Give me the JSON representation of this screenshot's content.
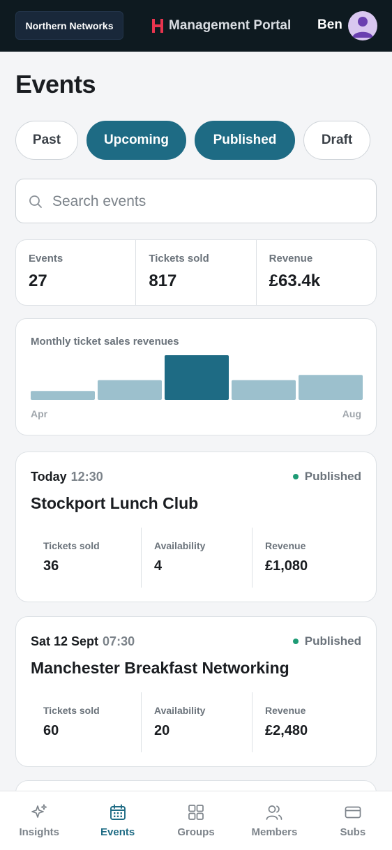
{
  "header": {
    "org_button": "Northern Networks",
    "portal_title": "Management Portal",
    "user_name": "Ben"
  },
  "page_title": "Events",
  "filters": [
    {
      "label": "Past",
      "active": false
    },
    {
      "label": "Upcoming",
      "active": true
    },
    {
      "label": "Published",
      "active": true
    },
    {
      "label": "Draft",
      "active": false
    }
  ],
  "search": {
    "placeholder": "Search events",
    "value": ""
  },
  "stats": [
    {
      "label": "Events",
      "value": "27"
    },
    {
      "label": "Tickets sold",
      "value": "817"
    },
    {
      "label": "Revenue",
      "value": "£63.4k"
    }
  ],
  "chart": {
    "title": "Monthly ticket sales revenues",
    "start_label": "Apr",
    "end_label": "Aug"
  },
  "chart_data": {
    "type": "bar",
    "title": "Monthly ticket sales revenues",
    "categories": [
      "Apr",
      "May",
      "Jun",
      "Jul",
      "Aug"
    ],
    "values": [
      20,
      44,
      100,
      44,
      56
    ],
    "highlight_index": 2,
    "ylim": [
      0,
      100
    ],
    "grid": false,
    "xlabel": "",
    "ylabel": ""
  },
  "events": [
    {
      "day": "Today",
      "time": "12:30",
      "status": "Published",
      "title": "Stockport Lunch Club",
      "metrics": [
        {
          "label": "Tickets sold",
          "value": "36"
        },
        {
          "label": "Availability",
          "value": "4"
        },
        {
          "label": "Revenue",
          "value": "£1,080"
        }
      ]
    },
    {
      "day": "Sat 12 Sept",
      "time": "07:30",
      "status": "Published",
      "title": "Manchester Breakfast Networking",
      "metrics": [
        {
          "label": "Tickets sold",
          "value": "60"
        },
        {
          "label": "Availability",
          "value": "20"
        },
        {
          "label": "Revenue",
          "value": "£2,480"
        }
      ]
    }
  ],
  "nav": [
    {
      "label": "Insights",
      "icon": "sparkle-icon",
      "active": false
    },
    {
      "label": "Events",
      "icon": "calendar-icon",
      "active": true
    },
    {
      "label": "Groups",
      "icon": "grid-icon",
      "active": false
    },
    {
      "label": "Members",
      "icon": "users-icon",
      "active": false
    },
    {
      "label": "Subs",
      "icon": "card-icon",
      "active": false
    }
  ],
  "colors": {
    "brand": "#1e6b84",
    "bar_muted": "#9cc0cd",
    "status_published": "#1e9b75",
    "header_bg": "#0e1a20"
  }
}
